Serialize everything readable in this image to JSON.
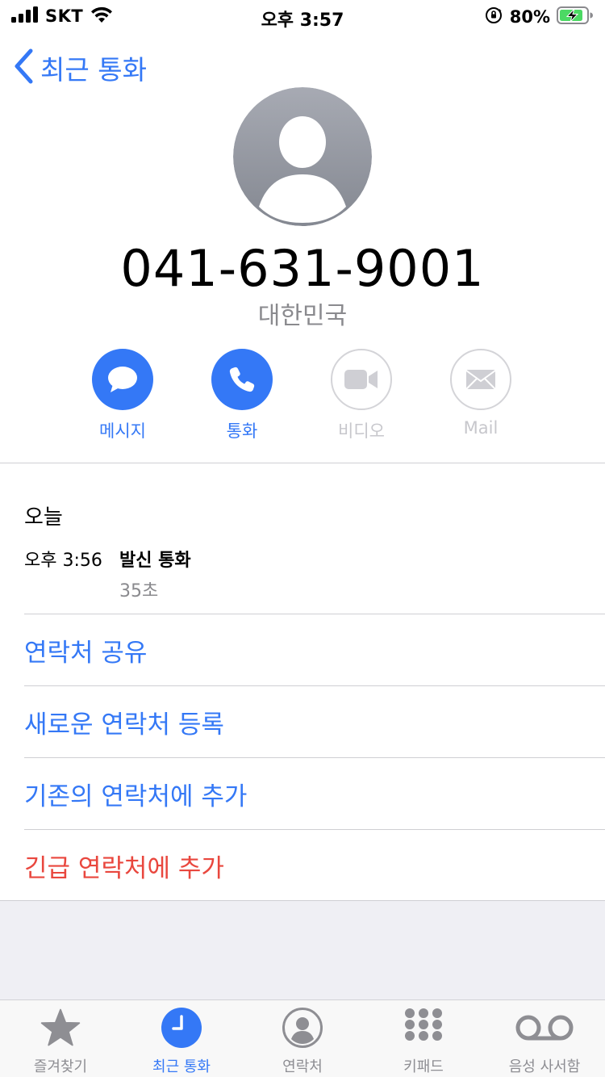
{
  "status_bar": {
    "carrier": "SKT",
    "time": "오후 3:57",
    "battery_percent": "80%",
    "icons": [
      "signal-icon",
      "wifi-icon",
      "orientation-lock-icon",
      "battery-charging-icon"
    ]
  },
  "nav": {
    "back_label": "최근 통화"
  },
  "contact": {
    "phone_number": "041-631-9001",
    "region": "대한민국"
  },
  "actions": [
    {
      "label": "메시지",
      "icon": "message-icon",
      "enabled": true
    },
    {
      "label": "통화",
      "icon": "phone-icon",
      "enabled": true
    },
    {
      "label": "비디오",
      "icon": "video-icon",
      "enabled": false
    },
    {
      "label": "Mail",
      "icon": "mail-icon",
      "enabled": false
    }
  ],
  "call_log": {
    "date": "오늘",
    "entries": [
      {
        "time": "오후 3:56",
        "type": "발신 통화",
        "duration": "35초"
      }
    ]
  },
  "options": [
    {
      "label": "연락처 공유"
    },
    {
      "label": "새로운 연락처 등록"
    },
    {
      "label": "기존의 연락처에 추가"
    },
    {
      "label": "긴급 연락처에 추가"
    }
  ],
  "tab_bar": {
    "tabs": [
      {
        "label": "즐겨찾기",
        "icon": "star-icon",
        "active": false
      },
      {
        "label": "최근 통화",
        "icon": "clock-icon",
        "active": true
      },
      {
        "label": "연락처",
        "icon": "contacts-icon",
        "active": false
      },
      {
        "label": "키패드",
        "icon": "keypad-icon",
        "active": false
      },
      {
        "label": "음성 사서함",
        "icon": "voicemail-icon",
        "active": false
      }
    ]
  },
  "colors": {
    "accent": "#3478f6",
    "destructive": "#e9473e",
    "secondary_text": "#8a8a8e",
    "disabled": "#c7c7cc",
    "battery_green": "#4cd964"
  }
}
